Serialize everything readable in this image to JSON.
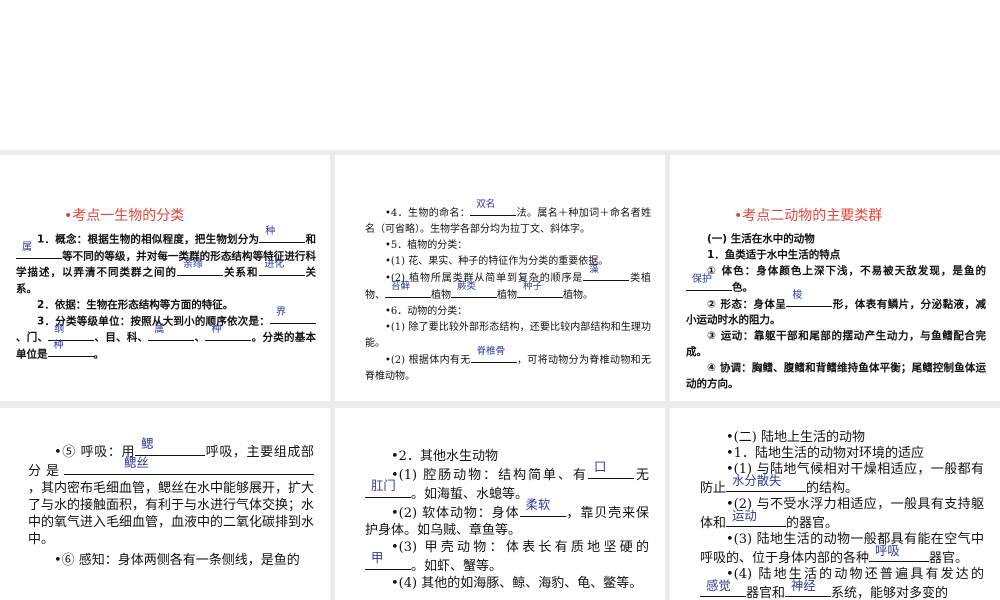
{
  "p1": {
    "title": "•考点一生物的分类",
    "l1a": "1．概念：根据生物的相似程度，把生物划分为",
    "a1": "种",
    "l1b": "和",
    "a2": "属",
    "l1c": "等不同的等级，并对每一类群的形态结构等特征进行科学描述，以弄清不同类群之间的",
    "a3": "亲缘",
    "l1d": "关系和",
    "a4": "进化",
    "l1e": "关系。",
    "l2": "2．依据：生物在形态结构等方面的特征。",
    "l3a": "3．分类等级单位：按照从大到小的顺序依次是：",
    "a5": "界",
    "l3b": "、门、",
    "a6": "纲",
    "l3c": "、目、科、",
    "a7": "属",
    "l3d": "、",
    "a8": "种",
    "l3e": "。分类的基本单位是",
    "a9": "种",
    "l3f": "。"
  },
  "p2": {
    "l4a": "•4．生物的命名：",
    "a1": "双名",
    "l4b": "法。属名＋种加词＋命名者姓名（可省略）。生物学各部分均为拉丁文、斜体字。",
    "l5": "•5．植物的分类：",
    "l5_1": "•(1) 花、果实、种子的特征作为分类的重要依据。",
    "l5_2a": "•(2) 植物所属类群从简单到复杂的顺序是",
    "a2": "藻",
    "l5_2b": "类植物、",
    "a3": "苔藓",
    "l5_2c": "植物",
    "a4": "蕨类",
    "l5_2d": "植物",
    "a5": "种子",
    "l5_2e": "植物。",
    "l6": "•6．动物的分类：",
    "l6_1": "•(1) 除了要比较外部形态结构，还要比较内部结构和生理功能。",
    "l6_2a": "•(2) 根据体内有无",
    "a6": "脊椎骨",
    "l6_2b": "，可将动物分为脊椎动物和无脊椎动物。"
  },
  "p3": {
    "title": "•考点二动物的主要类群",
    "h1": "(一) 生活在水中的动物",
    "h2": "1．鱼类适于水中生活的特点",
    "c1a": "① 体色：身体颜色上深下浅，不易被天敌发现，是鱼的",
    "a1": "保护",
    "c1b": "色。",
    "c2a": "② 形态：身体呈",
    "a2": "梭",
    "c2b": "形，体表有鳞片，分泌黏液，减小运动时水的阻力。",
    "c3": "③ 运动：靠躯干部和尾部的摆动产生动力，与鱼鳍配合完成。",
    "c4": "④ 协调：胸鳍、腹鳍和背鳍维持鱼体平衡；尾鳍控制鱼体运动的方向。"
  },
  "p4": {
    "c5a": "•⑤ 呼吸：用",
    "a1": "鳃",
    "c5b": "呼吸，主要组成部分是",
    "a2": "鳃丝",
    "c5c": "，其内密布毛细血管，鳃丝在水中能够展开，扩大了与水的接触面积，有利于与水进行气体交换；水中的氧气进入毛细血管，血液中的二氧化碳排到水中。",
    "c6": "•⑥ 感知：身体两侧各有一条侧线，是鱼的"
  },
  "p5": {
    "h": "•2．其他水生动物",
    "s1a": "•(1) 腔肠动物：结构简单、有",
    "a1": "口",
    "s1b": "无",
    "a2": "肛门",
    "s1c": "。如海蜇、水螅等。",
    "s2a": "•(2) 软体动物：身体",
    "a3": "柔软",
    "s2b": "，靠贝壳来保护身体。如乌贼、章鱼等。",
    "s3a": "•(3) 甲壳动物：体表长有质地坚硬的",
    "a4": "甲",
    "s3b": "。如虾、蟹等。",
    "s4": "•(4) 其他的如海豚、鲸、海豹、龟、鳖等。"
  },
  "p6": {
    "h1": "•(二) 陆地上生活的动物",
    "h2": "•1．陆地生活的动物对环境的适应",
    "s1a": "•(1) 与陆地气候相对干燥相适应，一般都有防止",
    "a1": "水分散失",
    "s1b": "的结构。",
    "s2a": "•(2) 与不受水浮力相适应，一般具有支持躯体和",
    "a2": "运动",
    "s2b": "的器官。",
    "s3a": "•(3) 陆地生活的动物一般都具有能在空气中呼吸的、位于身体内部的各种",
    "a3": "呼吸",
    "s3b": "器官。",
    "s4a": "•(4) 陆地生活的动物还普遍具有发达的",
    "a4": "感觉",
    "s4b": "器官和",
    "a5": "神经",
    "s4c": "系统，能够对多变的"
  }
}
